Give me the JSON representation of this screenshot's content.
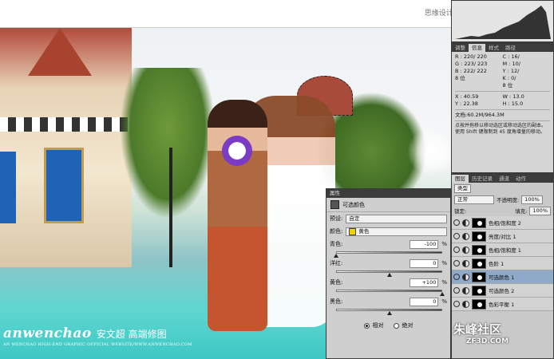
{
  "watermark": "思缘设计论坛 WWW.MISSYUAN.COM",
  "logo": {
    "brand": "anwenchao",
    "cn": "安文超 高端修图",
    "sub": "AN WENCHAO HIGH-END GRAPHIC OFFICIAL WEBSITE/WWW.ANWENCHAO.COM"
  },
  "info_panel": {
    "tabs": [
      "调整",
      "信息",
      "样式",
      "路径"
    ],
    "active_tab": 1,
    "rgb": {
      "r_label": "R :",
      "r": "220/ 220",
      "g_label": "G :",
      "g": "223/ 223",
      "b_label": "B :",
      "b": "222/ 222",
      "bits": "8 位"
    },
    "cmyk": {
      "c_label": "C :",
      "c": "16/",
      "m_label": "M :",
      "m": "10/",
      "y_label": "Y :",
      "y": "12/",
      "k_label": "K :",
      "k": "0/",
      "bits": "8 位"
    },
    "xy": {
      "x_label": "X :",
      "x": "40.59",
      "y_label": "Y :",
      "y": "22.38"
    },
    "wh": {
      "w_label": "W :",
      "w": "13.0",
      "h_label": "H :",
      "h": "15.0"
    },
    "doc": "文档:60.2M/964.3M",
    "note": "点按并拖移以移动选区或移动选区的副本。使用 Shift 键限制到 45 度角增量的移动。"
  },
  "layers_panel": {
    "tabs": [
      "图层",
      "历史记录",
      "通道",
      "动作"
    ],
    "kind": "类型",
    "blend": "正常",
    "opacity_label": "不透明度:",
    "opacity": "100%",
    "lock_label": "锁定:",
    "fill_label": "填充:",
    "fill": "100%",
    "layers": [
      {
        "name": "色相/饱和度 2",
        "sel": false
      },
      {
        "name": "亮度/对比 1",
        "sel": false
      },
      {
        "name": "色相/饱和度 1",
        "sel": false
      },
      {
        "name": "色阶 1",
        "sel": false
      },
      {
        "name": "可选颜色 1",
        "sel": true
      },
      {
        "name": "可选颜色 2",
        "sel": false
      },
      {
        "name": "色彩平衡 1",
        "sel": false
      }
    ]
  },
  "properties": {
    "header": "属性",
    "title": "可选颜色",
    "preset_label": "预设:",
    "preset": "自定",
    "color_label": "颜色:",
    "color": "黄色",
    "rows": [
      {
        "label": "青色:",
        "value": "-100",
        "unit": "%",
        "pct": 0.0
      },
      {
        "label": "洋红:",
        "value": "0",
        "unit": "%",
        "pct": 0.5
      },
      {
        "label": "黄色:",
        "value": "+100",
        "unit": "%",
        "pct": 1.0
      },
      {
        "label": "黑色:",
        "value": "0",
        "unit": "%",
        "pct": 0.5
      }
    ],
    "method_relative": "相对",
    "method_absolute": "绝对"
  },
  "site_mark": {
    "big": "朱峰社区",
    "small": "ZF3D.COM"
  }
}
